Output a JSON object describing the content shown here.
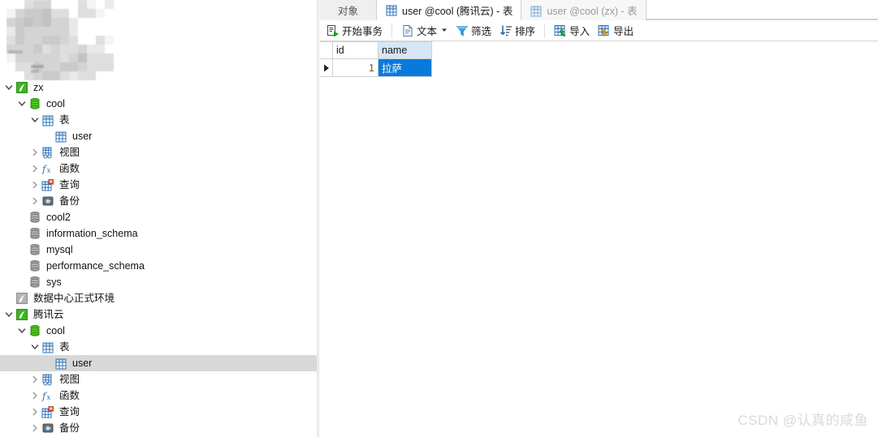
{
  "sidebar": {
    "censored_block": {
      "label": "blurred-region"
    },
    "tree": [
      {
        "id": "conn-zx",
        "label": "zx",
        "indent": 0,
        "icon": "navicat-connection-green",
        "twist": "down",
        "selected": false
      },
      {
        "id": "db-cool-zx",
        "label": "cool",
        "indent": 1,
        "icon": "database-green",
        "twist": "down",
        "selected": false
      },
      {
        "id": "tables-zx",
        "label": "表",
        "indent": 2,
        "icon": "table-folder",
        "twist": "down",
        "selected": false
      },
      {
        "id": "table-user-zx",
        "label": "user",
        "indent": 3,
        "icon": "table",
        "twist": "none",
        "selected": false
      },
      {
        "id": "views-zx",
        "label": "视图",
        "indent": 2,
        "icon": "view",
        "twist": "right",
        "selected": false
      },
      {
        "id": "functions-zx",
        "label": "函数",
        "indent": 2,
        "icon": "function-fx",
        "twist": "right",
        "selected": false
      },
      {
        "id": "queries-zx",
        "label": "查询",
        "indent": 2,
        "icon": "query",
        "twist": "right",
        "selected": false
      },
      {
        "id": "backups-zx",
        "label": "备份",
        "indent": 2,
        "icon": "backup",
        "twist": "right",
        "selected": false
      },
      {
        "id": "db-cool2",
        "label": "cool2",
        "indent": 1,
        "icon": "database-gray",
        "twist": "none",
        "selected": false
      },
      {
        "id": "db-information-schema",
        "label": "information_schema",
        "indent": 1,
        "icon": "database-gray",
        "twist": "none",
        "selected": false
      },
      {
        "id": "db-mysql",
        "label": "mysql",
        "indent": 1,
        "icon": "database-gray",
        "twist": "none",
        "selected": false
      },
      {
        "id": "db-performance-schema",
        "label": "performance_schema",
        "indent": 1,
        "icon": "database-gray",
        "twist": "none",
        "selected": false
      },
      {
        "id": "db-sys",
        "label": "sys",
        "indent": 1,
        "icon": "database-gray",
        "twist": "none",
        "selected": false
      },
      {
        "id": "conn-datacenter",
        "label": "数据中心正式环境",
        "indent": 0,
        "icon": "navicat-connection-gray",
        "twist": "none",
        "selected": false
      },
      {
        "id": "conn-tencent",
        "label": "腾讯云",
        "indent": 0,
        "icon": "navicat-connection-green",
        "twist": "down",
        "selected": false
      },
      {
        "id": "db-cool-tencent",
        "label": "cool",
        "indent": 1,
        "icon": "database-green",
        "twist": "down",
        "selected": false
      },
      {
        "id": "tables-tencent",
        "label": "表",
        "indent": 2,
        "icon": "table-folder",
        "twist": "down",
        "selected": false
      },
      {
        "id": "table-user-tencent",
        "label": "user",
        "indent": 3,
        "icon": "table",
        "twist": "none",
        "selected": true
      },
      {
        "id": "views-tencent",
        "label": "视图",
        "indent": 2,
        "icon": "view",
        "twist": "right",
        "selected": false
      },
      {
        "id": "functions-tencent",
        "label": "函数",
        "indent": 2,
        "icon": "function-fx",
        "twist": "right",
        "selected": false
      },
      {
        "id": "queries-tencent",
        "label": "查询",
        "indent": 2,
        "icon": "query",
        "twist": "right",
        "selected": false
      },
      {
        "id": "backups-tencent",
        "label": "备份",
        "indent": 2,
        "icon": "backup",
        "twist": "right",
        "selected": false
      }
    ]
  },
  "tabs": [
    {
      "id": "objects",
      "label": "对象",
      "state": "inactive-plain",
      "icon": "none"
    },
    {
      "id": "user-cool-tencent",
      "label": "user @cool (腾讯云) - 表",
      "state": "active",
      "icon": "table"
    },
    {
      "id": "user-cool-zx",
      "label": "user @cool (zx) - 表",
      "state": "inactive",
      "icon": "table"
    }
  ],
  "toolbar": {
    "buttons": [
      {
        "id": "begin-transaction",
        "label": "开始事务",
        "icon": "transaction-icon",
        "caret": false
      },
      {
        "id": "text",
        "label": "文本",
        "icon": "text-document-icon",
        "caret": true
      },
      {
        "id": "filter",
        "label": "筛选",
        "icon": "funnel-icon",
        "caret": false
      },
      {
        "id": "sort",
        "label": "排序",
        "icon": "sort-descending-icon",
        "caret": false
      },
      {
        "id": "import",
        "label": "导入",
        "icon": "import-icon",
        "caret": false
      },
      {
        "id": "export",
        "label": "导出",
        "icon": "export-icon",
        "caret": false
      }
    ]
  },
  "grid": {
    "columns": [
      {
        "id": "id",
        "label": "id",
        "selected": false,
        "align": "right"
      },
      {
        "id": "name",
        "label": "name",
        "selected": true,
        "align": "left"
      }
    ],
    "rows": [
      {
        "indicator": "current-row-arrow",
        "cells": [
          {
            "col": "id",
            "value": "1",
            "selected": false
          },
          {
            "col": "name",
            "value": "拉萨",
            "selected": true
          }
        ]
      }
    ]
  },
  "watermark": {
    "text": "CSDN @认真的咸鱼"
  },
  "colors": {
    "selection_blue": "#0a7ada",
    "header_selected_blue": "#d6e6f7",
    "tree_selection_gray": "#d8d8d8",
    "connection_green": "#3cb521",
    "watermark_gray": "#d9d9d9"
  }
}
